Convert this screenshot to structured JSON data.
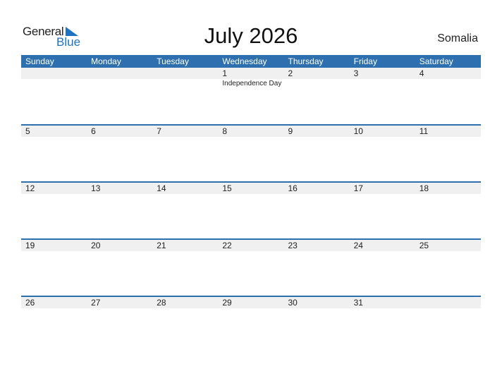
{
  "logo": {
    "text_general": "General",
    "text_blue": "Blue",
    "brand_color": "#1d72c2"
  },
  "title": "July 2026",
  "country": "Somalia",
  "header_color": "#2e6fb0",
  "weekdays": [
    "Sunday",
    "Monday",
    "Tuesday",
    "Wednesday",
    "Thursday",
    "Friday",
    "Saturday"
  ],
  "weeks": [
    {
      "days": [
        "",
        "",
        "",
        "1",
        "2",
        "3",
        "4"
      ],
      "events": [
        "",
        "",
        "",
        "Independence Day",
        "",
        "",
        ""
      ]
    },
    {
      "days": [
        "5",
        "6",
        "7",
        "8",
        "9",
        "10",
        "11"
      ],
      "events": [
        "",
        "",
        "",
        "",
        "",
        "",
        ""
      ]
    },
    {
      "days": [
        "12",
        "13",
        "14",
        "15",
        "16",
        "17",
        "18"
      ],
      "events": [
        "",
        "",
        "",
        "",
        "",
        "",
        ""
      ]
    },
    {
      "days": [
        "19",
        "20",
        "21",
        "22",
        "23",
        "24",
        "25"
      ],
      "events": [
        "",
        "",
        "",
        "",
        "",
        "",
        ""
      ]
    },
    {
      "days": [
        "26",
        "27",
        "28",
        "29",
        "30",
        "31",
        ""
      ],
      "events": [
        "",
        "",
        "",
        "",
        "",
        "",
        ""
      ]
    }
  ]
}
